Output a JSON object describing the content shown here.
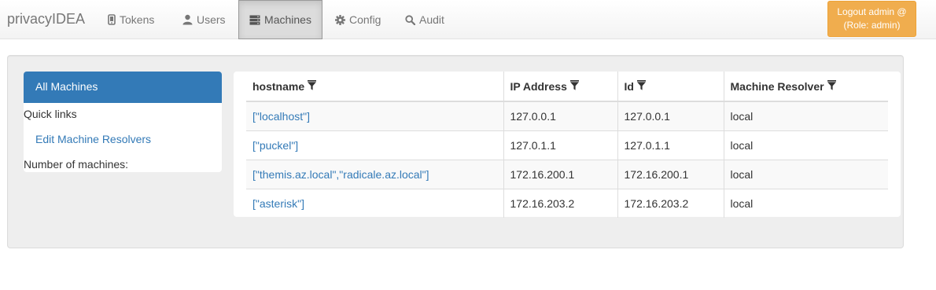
{
  "navbar": {
    "brand": "privacyIDEA",
    "items": [
      {
        "label": "Tokens",
        "icon": "phone-icon"
      },
      {
        "label": "Users",
        "icon": "user-icon"
      },
      {
        "label": "Machines",
        "icon": "server-icon",
        "active": true
      },
      {
        "label": "Config",
        "icon": "gear-icon"
      },
      {
        "label": "Audit",
        "icon": "search-icon"
      }
    ],
    "logout": {
      "line1": "Logout admin @",
      "line2": "(Role: admin)"
    }
  },
  "sidebar": {
    "all_machines": "All Machines",
    "quick_links": "Quick links",
    "edit_resolvers": "Edit Machine Resolvers",
    "number_of_machines": "Number of machines:"
  },
  "table": {
    "headers": [
      "hostname",
      "IP Address",
      "Id",
      "Machine Resolver"
    ],
    "filter_icon": "filter-icon",
    "rows": [
      {
        "hostname": "[\"localhost\"]",
        "ip": "127.0.0.1",
        "id": "127.0.0.1",
        "resolver": "local"
      },
      {
        "hostname": "[\"puckel\"]",
        "ip": "127.0.1.1",
        "id": "127.0.1.1",
        "resolver": "local"
      },
      {
        "hostname": "[\"themis.az.local\",\"radicale.az.local\"]",
        "ip": "172.16.200.1",
        "id": "172.16.200.1",
        "resolver": "local"
      },
      {
        "hostname": "[\"asterisk\"]",
        "ip": "172.16.203.2",
        "id": "172.16.203.2",
        "resolver": "local"
      }
    ]
  },
  "colors": {
    "primary": "#337ab7",
    "warning": "#f0ad4e",
    "muted_text": "#777777",
    "well_bg": "#eeeeee"
  }
}
